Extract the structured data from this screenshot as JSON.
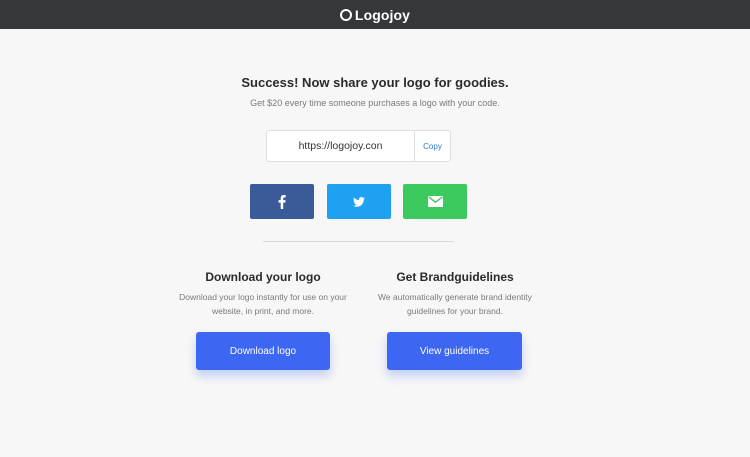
{
  "header": {
    "brand_name": "Logojoy"
  },
  "share": {
    "headline": "Success! Now share your logo for goodies.",
    "subline": "Get $20 every time someone purchases a logo with your code.",
    "url_value": "https://logojoy.con",
    "copy_label": "Copy"
  },
  "social": [
    {
      "network": "facebook",
      "icon": "facebook-icon",
      "color": "#3b5a98"
    },
    {
      "network": "twitter",
      "icon": "twitter-icon",
      "color": "#1ea1f1"
    },
    {
      "network": "email",
      "icon": "mail-icon",
      "color": "#3cca5e"
    }
  ],
  "download": {
    "title": "Download your logo",
    "description_line1": "Download your logo instantly for use on your",
    "description_line2": "website, in print, and more.",
    "button_label": "Download logo"
  },
  "guidelines": {
    "title": "Get Brandguidelines",
    "description_line1": "We automatically generate brand identity",
    "description_line2": "guidelines for your brand.",
    "button_label": "View guidelines"
  },
  "colors": {
    "topbar": "#34383b",
    "primary_button": "#3d67f2",
    "link": "#2e78c7",
    "background": "#f7f7f7"
  }
}
